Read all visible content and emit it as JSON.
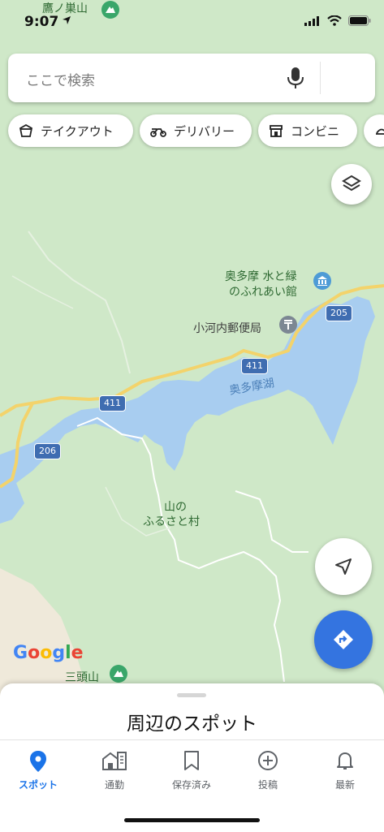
{
  "status_bar": {
    "time": "9:07",
    "peak_label": "鷹ノ巣山"
  },
  "search": {
    "placeholder": "ここで検索"
  },
  "chips": [
    {
      "label": "テイクアウト",
      "icon": "takeout-icon"
    },
    {
      "label": "デリバリー",
      "icon": "delivery-icon"
    },
    {
      "label": "コンビニ",
      "icon": "convenience-store-icon"
    }
  ],
  "map": {
    "labels": {
      "visitor_center_line1": "奥多摩 水と緑",
      "visitor_center_line2": "のふれあい館",
      "post_office": "小河内郵便局",
      "lake": "奥多摩湖",
      "village_line1": "山の",
      "village_line2": "ふるさと村",
      "mountain_bottom": "三頭山"
    },
    "route_shields": {
      "r205": "205",
      "r411a": "411",
      "r411b": "411",
      "r206": "206"
    },
    "attribution": "Google",
    "colors": {
      "land": "#cfe8c8",
      "water": "#a8cdf0",
      "road": "#f3d36b",
      "accent": "#3474e0"
    }
  },
  "bottom_sheet": {
    "title": "周辺のスポット"
  },
  "tabs": [
    {
      "label": "スポット",
      "icon": "location-pin-icon",
      "active": true
    },
    {
      "label": "通勤",
      "icon": "commute-icon",
      "active": false
    },
    {
      "label": "保存済み",
      "icon": "bookmark-icon",
      "active": false
    },
    {
      "label": "投稿",
      "icon": "add-circle-icon",
      "active": false
    },
    {
      "label": "最新",
      "icon": "bell-icon",
      "active": false
    }
  ]
}
